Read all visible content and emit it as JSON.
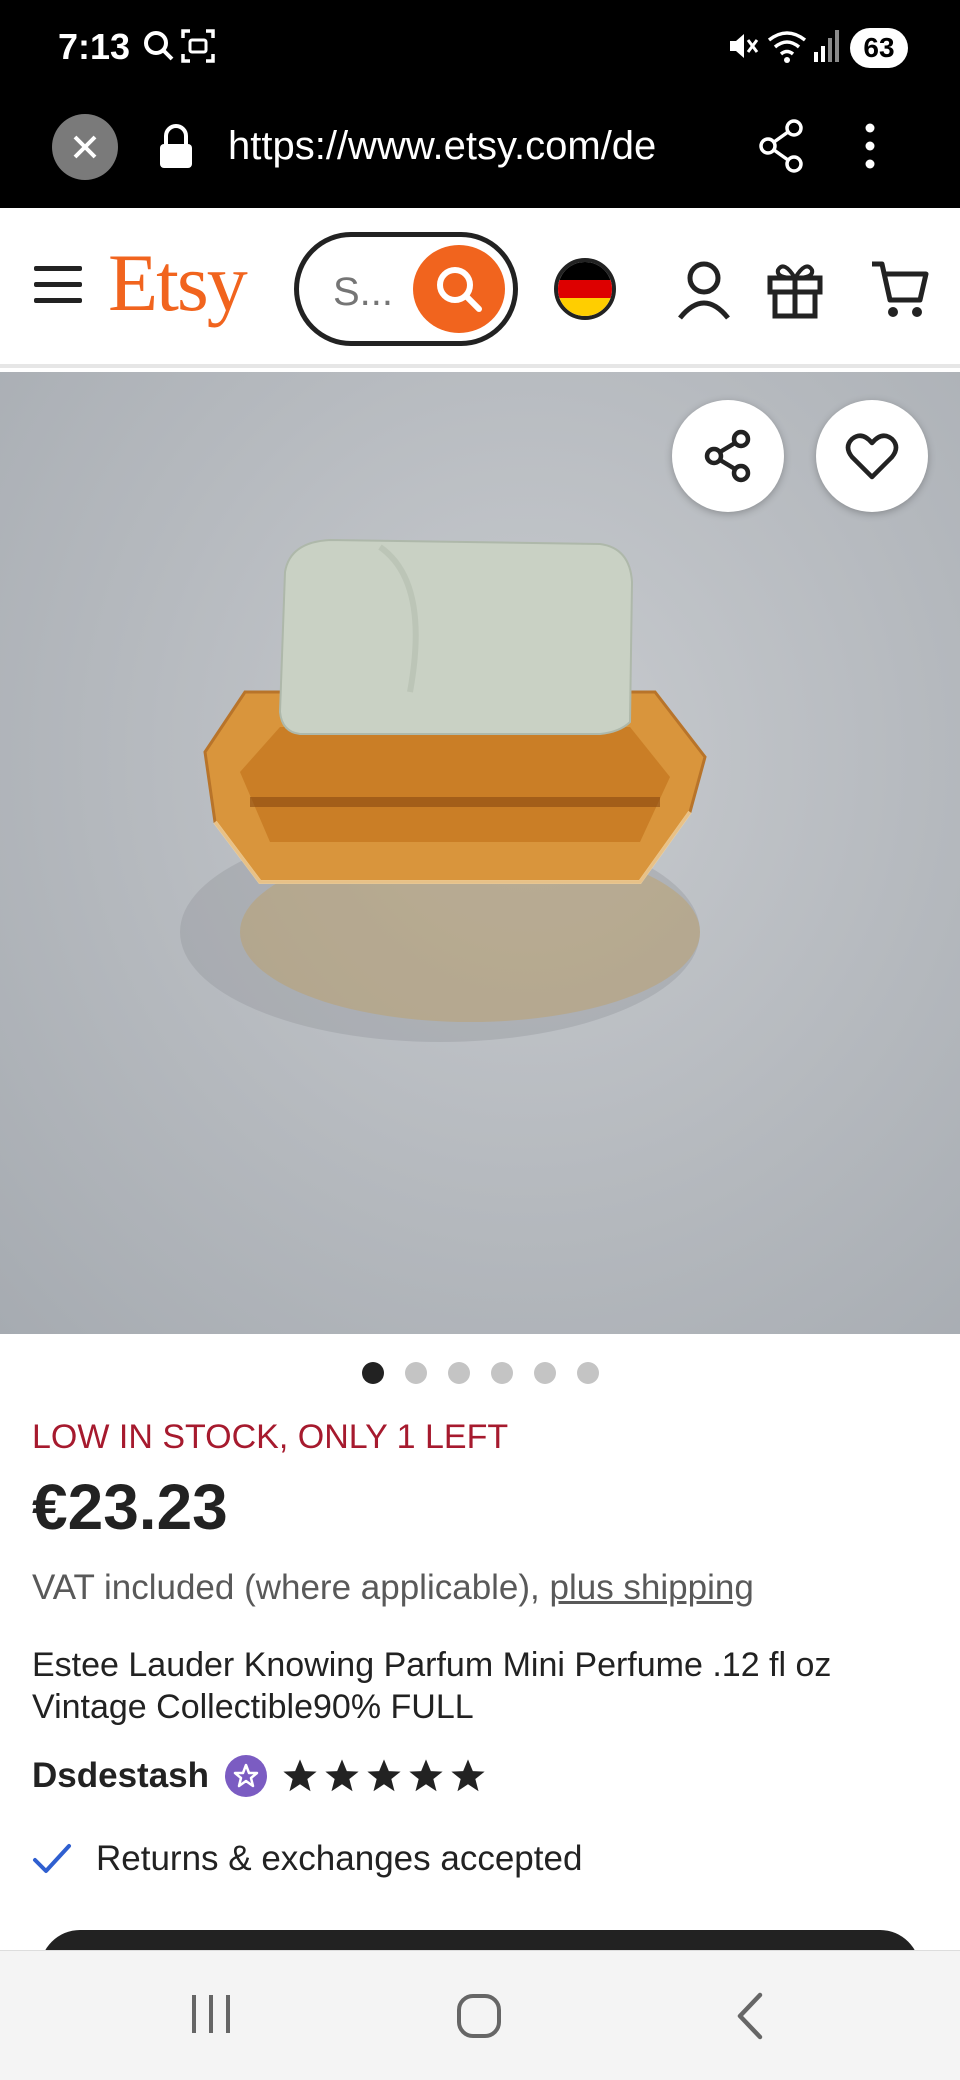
{
  "status": {
    "time": "7:13",
    "battery": "63",
    "icons": [
      "search-icon",
      "screenshot-icon",
      "mute-icon",
      "wifi-icon",
      "signal-icon"
    ]
  },
  "browser": {
    "url": "https://www.etsy.com/de",
    "icons": [
      "close-icon",
      "lock-icon",
      "share-icon",
      "more-vertical-icon"
    ]
  },
  "header": {
    "logo": "Etsy",
    "search_placeholder": "S...",
    "icons": [
      "menu-icon",
      "search-icon",
      "germany-flag-icon",
      "account-icon",
      "gift-icon",
      "cart-icon"
    ]
  },
  "gallery": {
    "image_count": 6,
    "active_index": 0,
    "buttons": [
      "share-icon",
      "heart-icon"
    ]
  },
  "product": {
    "stock_notice": "LOW IN STOCK, ONLY 1 LEFT",
    "price": "€23.23",
    "vat_text": "VAT included (where applicable), ",
    "shipping_link": "plus shipping",
    "title": "Estee Lauder Knowing Parfum Mini Perfume .12 fl oz Vintage Collectible90% FULL",
    "shop_name": "Dsdestash",
    "rating": 5,
    "returns_text": "Returns & exchanges accepted"
  },
  "colors": {
    "brand": "#F1641E",
    "stock_red": "#A61A2E",
    "star_seller": "#7B5CC2",
    "check_blue": "#2F5FD0"
  },
  "navbar": {
    "icons": [
      "recent-apps-icon",
      "home-icon",
      "back-icon"
    ]
  }
}
